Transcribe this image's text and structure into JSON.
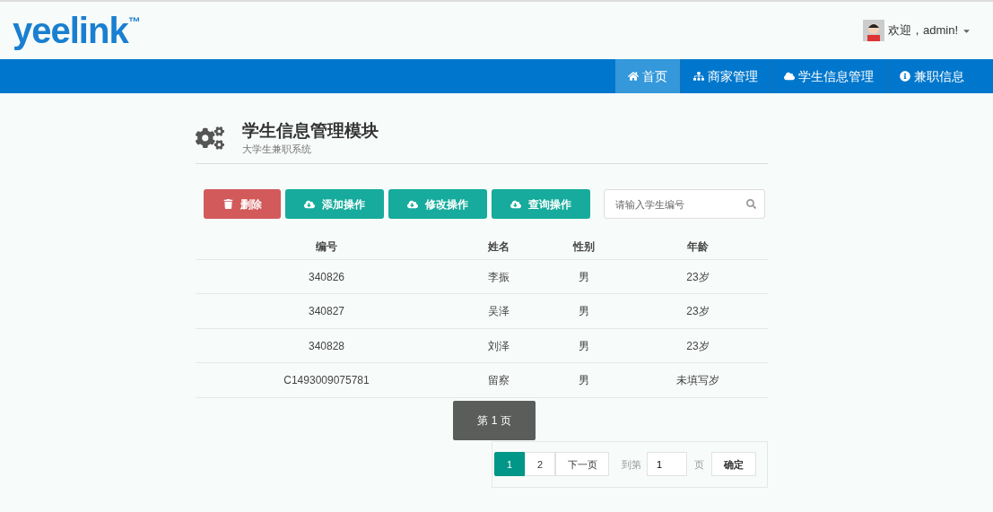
{
  "brand": {
    "name": "yeelink",
    "mark": "™"
  },
  "user": {
    "greeting": "欢迎，admin!"
  },
  "nav": [
    {
      "label": "首页",
      "selected": true
    },
    {
      "label": "商家管理",
      "selected": false
    },
    {
      "label": "学生信息管理",
      "selected": false
    },
    {
      "label": "兼职信息",
      "selected": false
    }
  ],
  "page_header": {
    "title": "学生信息管理模块",
    "subtitle": "大学生兼职系统"
  },
  "toolbar": [
    {
      "label": "删除",
      "kind": "danger"
    },
    {
      "label": "添加操作",
      "kind": "primary"
    },
    {
      "label": "修改操作",
      "kind": "primary"
    },
    {
      "label": "查询操作",
      "kind": "primary"
    }
  ],
  "search": {
    "placeholder": "请输入学生编号"
  },
  "table": {
    "columns": [
      "编号",
      "姓名",
      "性别",
      "年龄"
    ],
    "rows": [
      [
        "340826",
        "李振",
        "男",
        "23岁"
      ],
      [
        "340827",
        "吴泽",
        "男",
        "23岁"
      ],
      [
        "340828",
        "刘泽",
        "男",
        "23岁"
      ],
      [
        "C1493009075781",
        "留察",
        "男",
        "未填写岁"
      ]
    ]
  },
  "tooltip": "第 1 页",
  "pagination": {
    "pages": [
      {
        "label": "1",
        "selected": true
      },
      {
        "label": "2",
        "selected": false
      }
    ],
    "next": "下一页",
    "goto_label": "到第",
    "goto_value": "1",
    "page_suffix": "页",
    "confirm": "确定"
  }
}
